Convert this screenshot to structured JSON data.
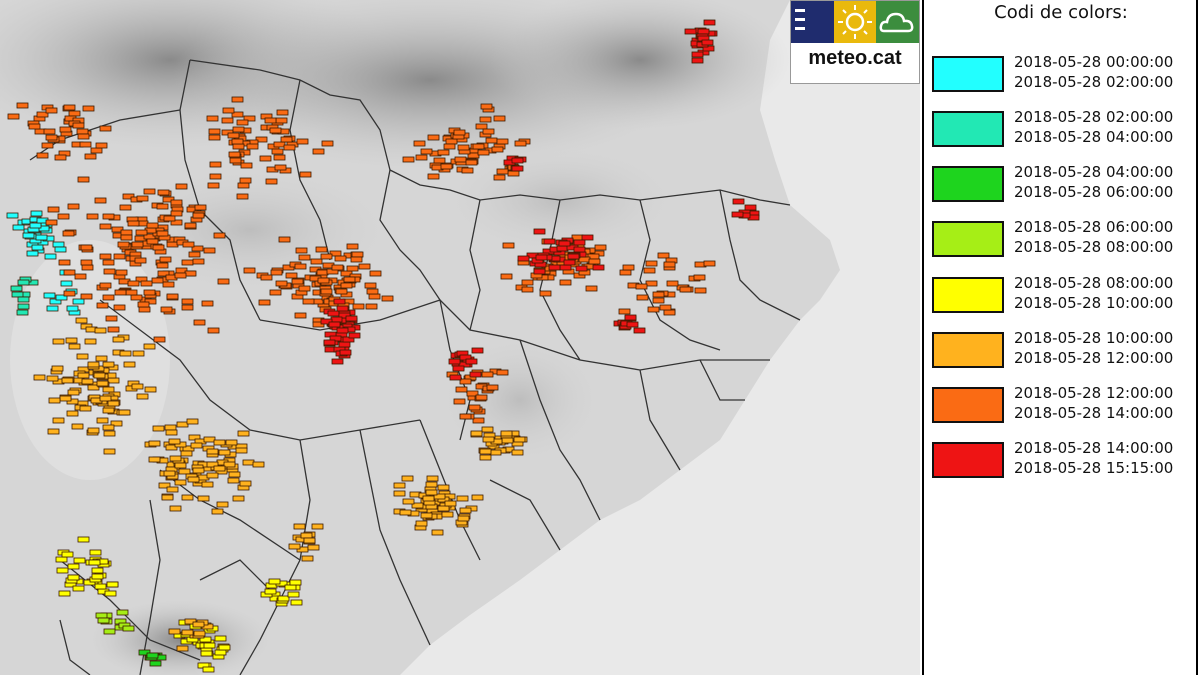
{
  "logo": {
    "brand": "meteo.cat",
    "icons": [
      "menu-lines-icon",
      "sun-icon",
      "cloud-icon"
    ],
    "colors": {
      "tile1": "#1f2c6e",
      "tile2": "#e9b90c",
      "tile3": "#3c8d3e"
    }
  },
  "legend": {
    "title": "Codi de colors:",
    "items": [
      {
        "color": "#22ffff",
        "start": "2018-05-28 00:00:00",
        "end": "2018-05-28 02:00:00"
      },
      {
        "color": "#22e8b4",
        "start": "2018-05-28 02:00:00",
        "end": "2018-05-28 04:00:00"
      },
      {
        "color": "#1ed41e",
        "start": "2018-05-28 04:00:00",
        "end": "2018-05-28 06:00:00"
      },
      {
        "color": "#a6ee16",
        "start": "2018-05-28 06:00:00",
        "end": "2018-05-28 08:00:00"
      },
      {
        "color": "#ffff00",
        "start": "2018-05-28 08:00:00",
        "end": "2018-05-28 10:00:00"
      },
      {
        "color": "#ffb21e",
        "start": "2018-05-28 10:00:00",
        "end": "2018-05-28 12:00:00"
      },
      {
        "color": "#fa6b14",
        "start": "2018-05-28 12:00:00",
        "end": "2018-05-28 14:00:00"
      },
      {
        "color": "#ee1414",
        "start": "2018-05-28 14:00:00",
        "end": "2018-05-28 15:15:00"
      }
    ]
  },
  "map": {
    "sea_color": "#e9e9e9",
    "terrain_light": "#d2d2d2",
    "terrain_dark": "#8a8a8a",
    "border_color": "#333333"
  }
}
